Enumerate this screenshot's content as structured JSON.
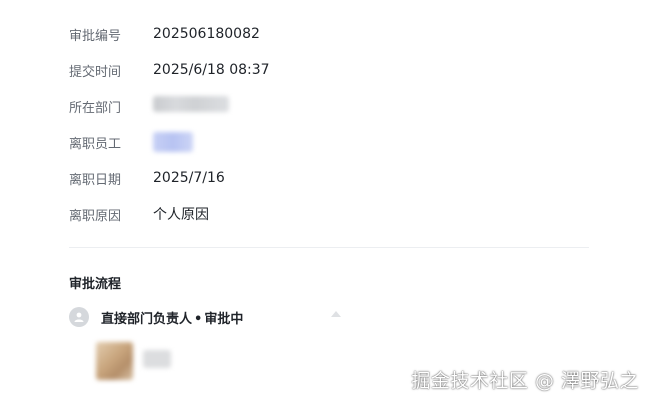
{
  "fields": [
    {
      "label": "审批编号",
      "value": "202506180082"
    },
    {
      "label": "提交时间",
      "value": "2025/6/18 08:37"
    },
    {
      "label": "所在部门",
      "value": ""
    },
    {
      "label": "离职员工",
      "value": ""
    },
    {
      "label": "离职日期",
      "value": "2025/7/16"
    },
    {
      "label": "离职原因",
      "value": "个人原因"
    }
  ],
  "workflow": {
    "section_title": "审批流程",
    "step": {
      "role": "直接部门负责人",
      "separator": "•",
      "status": "审批中"
    }
  },
  "watermark": "掘金技术社区 @ 澤野弘之",
  "colors": {
    "label": "#646a73",
    "value": "#1f2329",
    "divider": "#eceef1",
    "avatar_placeholder": "#d5d8dc"
  },
  "icons": [
    "user-avatar-icon",
    "chevron-up-icon"
  ]
}
